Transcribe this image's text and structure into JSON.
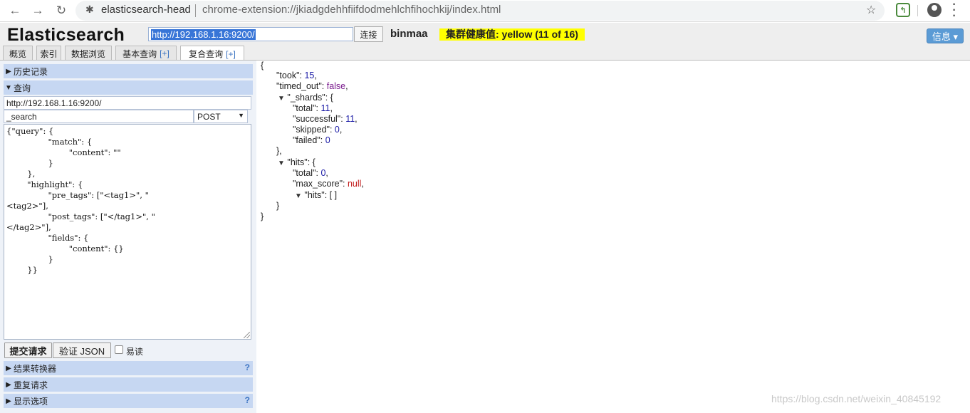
{
  "browser": {
    "tab_name": "elasticsearch-head",
    "url": "chrome-extension://jkiadgdehhfiifdodmehlchfihochkij/index.html"
  },
  "header": {
    "logo": "Elasticsearch",
    "connect_url": "http://192.168.1.16:9200/",
    "connect_label": "连接",
    "cluster_name": "binmaa",
    "health": "集群健康值: yellow (11 of 16)",
    "info_label": "信息 ▾"
  },
  "tabs": [
    {
      "label": "概览"
    },
    {
      "label": "索引"
    },
    {
      "label": "数据浏览"
    },
    {
      "label": "基本查询",
      "plus": "[+]"
    },
    {
      "label": "复合查询",
      "plus": "[+]"
    }
  ],
  "left": {
    "history_label": "历史记录",
    "query_label": "查询",
    "query_url": "http://192.168.1.16:9200/",
    "query_path": "_search",
    "query_method": "POST",
    "query_body": "{\"query\": {\n                \"match\": {\n                        \"content\": \"\"\n                }\n        },\n        \"highlight\": {\n                \"pre_tags\": [\"<tag1>\", \"\n<tag2>\"],\n                \"post_tags\": [\"</tag1>\", \"\n</tag2>\"],\n                \"fields\": {\n                        \"content\": {}\n                }\n        }}",
    "submit_label": "提交请求",
    "validate_label": "验证 JSON",
    "pretty_label": "易读",
    "transformer_label": "结果转换器",
    "repeat_label": "重复请求",
    "display_label": "显示选项",
    "help_mark": "?"
  },
  "result": {
    "open_brace": "{",
    "took_key": "\"took\": ",
    "took_val": "15",
    "timed_out_key": "\"timed_out\": ",
    "timed_out_val": "false",
    "shards_key": "\"_shards\": {",
    "total_key": "\"total\": ",
    "total_val": "11",
    "successful_key": "\"successful\": ",
    "successful_val": "11",
    "skipped_key": "\"skipped\": ",
    "skipped_val": "0",
    "failed_key": "\"failed\": ",
    "failed_val": "0",
    "close_shards": "},",
    "hits_key": "\"hits\": {",
    "hits_total_key": "\"total\": ",
    "hits_total_val": "0",
    "max_score_key": "\"max_score\": ",
    "max_score_val": "null",
    "hits_arr": "\"hits\": [ ]",
    "close_hits": "}",
    "close_brace": "}"
  },
  "watermark": "https://blog.csdn.net/weixin_40845192"
}
